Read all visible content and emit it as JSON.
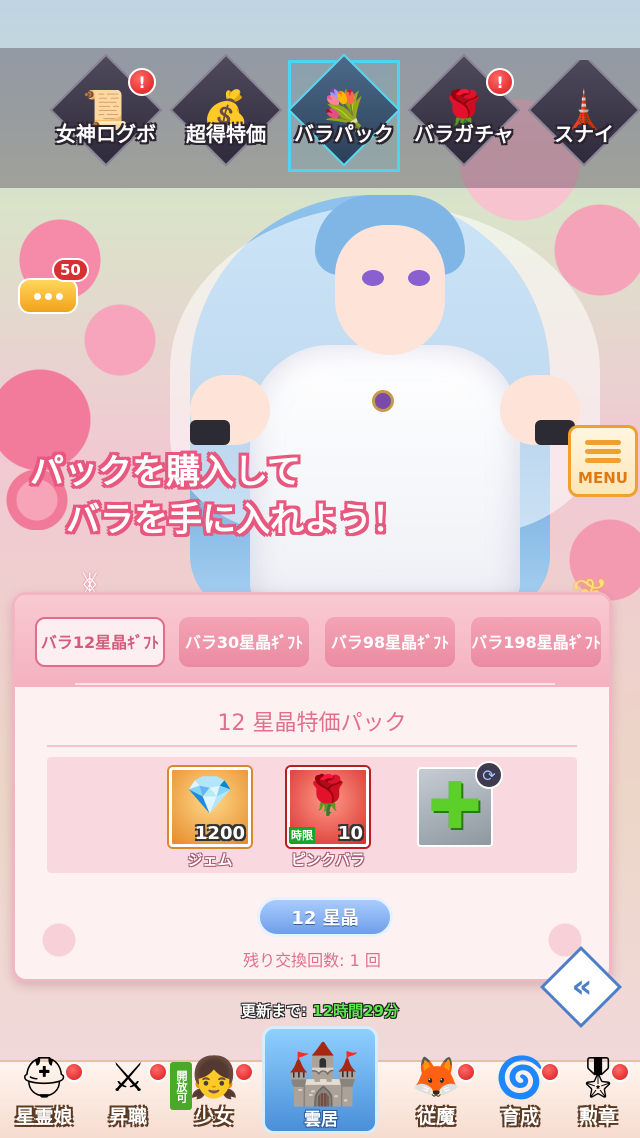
{
  "top_nav": {
    "tabs": [
      {
        "label": "女神ログボ",
        "icon": "scroll-icon",
        "alert": true,
        "active": false
      },
      {
        "label": "超得特価",
        "icon": "gift-bag-icon",
        "alert": false,
        "active": false
      },
      {
        "label": "バラパック",
        "icon": "rose-bouquet-icon",
        "alert": false,
        "active": true
      },
      {
        "label": "バラガチャ",
        "icon": "rose-icon",
        "alert": true,
        "active": false
      },
      {
        "label": "スナイ",
        "icon": "tower-icon",
        "alert": false,
        "active": false
      }
    ],
    "alert_mark": "!"
  },
  "chat": {
    "count": "50"
  },
  "menu": {
    "label": "MENU"
  },
  "promo": {
    "line1": "パックを購入して",
    "line2": "バラを手に入れよう！"
  },
  "pack_tabs": [
    {
      "label": "バラ12星晶ｷﾞﾌﾄ",
      "active": true
    },
    {
      "label": "バラ30星晶ｷﾞﾌﾄ",
      "active": false
    },
    {
      "label": "バラ98星晶ｷﾞﾌﾄ",
      "active": false
    },
    {
      "label": "バラ198星晶ｷﾞﾌﾄ",
      "active": false
    }
  ],
  "pack": {
    "title": "12 星晶特価パック",
    "items": [
      {
        "name": "ジェム",
        "qty": "1200",
        "icon": "gem-icon",
        "tag": ""
      },
      {
        "name": "ピンクバラ",
        "qty": "10",
        "icon": "pink-rose-icon",
        "tag": "時限"
      }
    ],
    "add_slot_icon": "plus-icon",
    "price": "12 星晶",
    "remaining": "残り交換回数: 1 回"
  },
  "timer": {
    "label": "更新まで:",
    "value": "12時間29分"
  },
  "bottom_nav": {
    "items": [
      {
        "label": "星霊娘",
        "icon": "knight-helmet-icon",
        "alert": true
      },
      {
        "label": "昇職",
        "icon": "crossed-swords-icon",
        "alert": true
      },
      {
        "label": "少女",
        "icon": "girl-portrait-icon",
        "alert": true,
        "badge": "開放可"
      },
      {
        "label": "雲居",
        "icon": "castle-icon",
        "alert": false
      },
      {
        "label": "従魔",
        "icon": "fox-mask-icon",
        "alert": true
      },
      {
        "label": "育成",
        "icon": "portal-icon",
        "alert": true
      },
      {
        "label": "勲章",
        "icon": "medal-icon",
        "alert": true
      }
    ]
  },
  "colors": {
    "accent_pink": "#e0708c",
    "active_tab_cyan": "#4fd3f2",
    "menu_orange": "#f0a030",
    "price_blue": "#6f9ee8",
    "alert_red": "#d81818"
  }
}
